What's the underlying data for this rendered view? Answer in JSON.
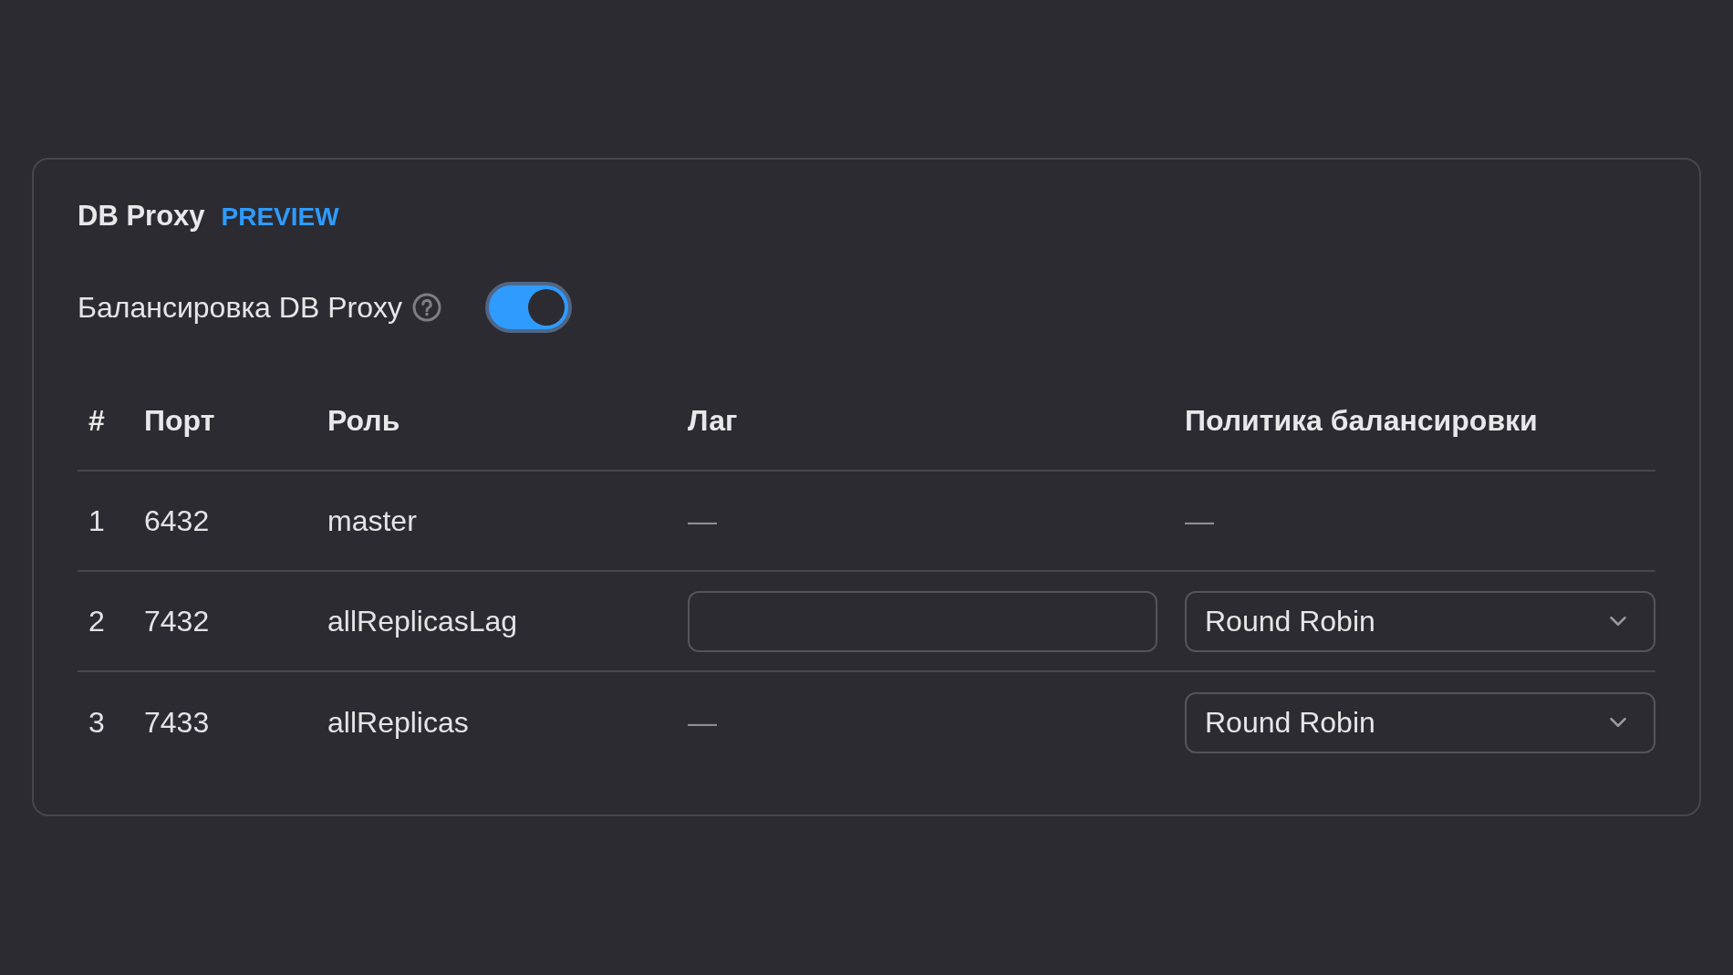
{
  "section": {
    "title": "DB Proxy",
    "badge": "PREVIEW"
  },
  "balancing": {
    "label": "Балансировка DB Proxy",
    "on": true
  },
  "table": {
    "columns": [
      "#",
      "Порт",
      "Роль",
      "Лаг",
      "Политика балансировки"
    ],
    "rows": [
      {
        "number": "1",
        "port": "6432",
        "role": "master",
        "lag": {
          "kind": "text",
          "value": "—"
        },
        "policy": {
          "kind": "text",
          "value": "—"
        }
      },
      {
        "number": "2",
        "port": "7432",
        "role": "allReplicasLag",
        "lag": {
          "kind": "input"
        },
        "policy": {
          "kind": "select",
          "value": "Round Robin"
        }
      },
      {
        "number": "3",
        "port": "7433",
        "role": "allReplicas",
        "lag": {
          "kind": "text",
          "value": "—"
        },
        "policy": {
          "kind": "select",
          "value": "Round Robin"
        }
      }
    ]
  }
}
